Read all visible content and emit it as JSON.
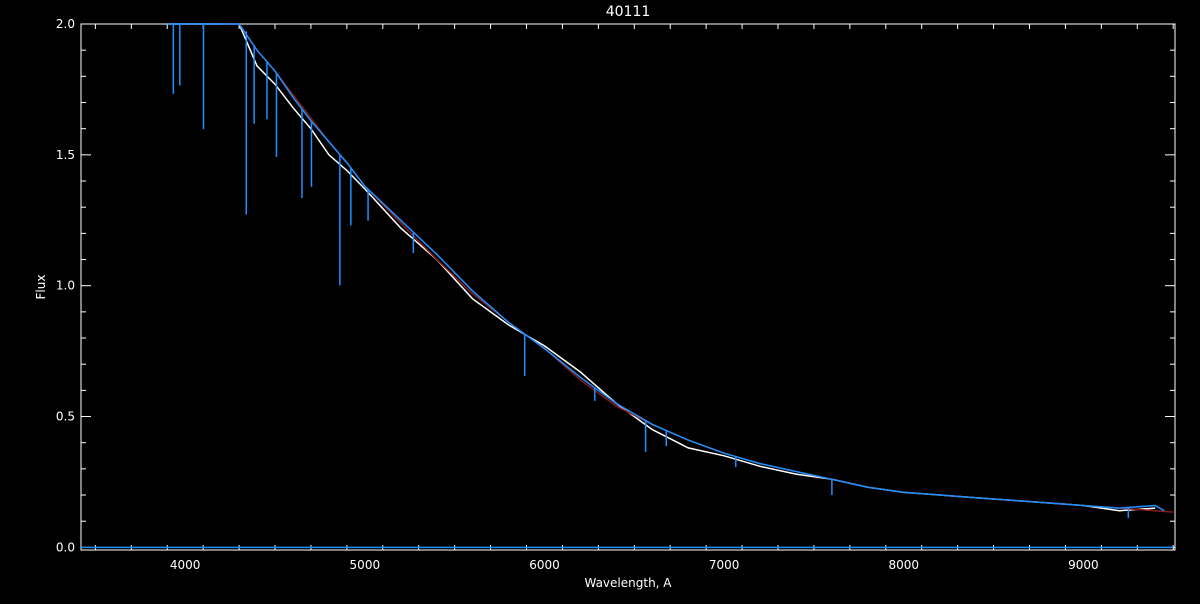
{
  "chart_data": {
    "type": "line",
    "title": "40111",
    "xlabel": "Wavelength, A",
    "ylabel": "Flux",
    "xlim": [
      3420,
      9510
    ],
    "ylim": [
      -0.01,
      2.0
    ],
    "x_ticks": [
      {
        "value": 4000,
        "label": "4000"
      },
      {
        "value": 5000,
        "label": "5000"
      },
      {
        "value": 6000,
        "label": "6000"
      },
      {
        "value": 7000,
        "label": "7000"
      },
      {
        "value": 8000,
        "label": "8000"
      },
      {
        "value": 9000,
        "label": "9000"
      }
    ],
    "y_ticks": [
      {
        "value": 0.0,
        "label": "0.0"
      },
      {
        "value": 0.5,
        "label": "0.5"
      },
      {
        "value": 1.0,
        "label": "1.0"
      },
      {
        "value": 1.5,
        "label": "1.5"
      },
      {
        "value": 2.0,
        "label": "2.0"
      }
    ],
    "grid": false,
    "series": [
      {
        "color": "#ffffff",
        "x": [
          3900,
          4100,
          4200,
          4300,
          4400,
          4500,
          4600,
          4700,
          4800,
          4900,
          5000,
          5200,
          5400,
          5600,
          5800,
          6000,
          6200,
          6400,
          6600,
          6800,
          7000,
          7200,
          7400,
          7600,
          7800,
          8000,
          8200,
          8400,
          8600,
          8800,
          9000,
          9200,
          9400
        ],
        "y": [
          2.3,
          2.2,
          2.1,
          2.0,
          1.84,
          1.77,
          1.68,
          1.6,
          1.5,
          1.44,
          1.37,
          1.22,
          1.1,
          0.95,
          0.85,
          0.77,
          0.67,
          0.55,
          0.45,
          0.38,
          0.35,
          0.31,
          0.28,
          0.26,
          0.23,
          0.21,
          0.2,
          0.19,
          0.18,
          0.17,
          0.16,
          0.14,
          0.15
        ]
      },
      {
        "color": "#8b1a1a",
        "x": [
          4200,
          4300,
          4400,
          4500,
          4600,
          4700,
          4800,
          4900,
          5000,
          5200,
          5400,
          5600,
          5800,
          6000,
          6200,
          6400,
          6600,
          6800,
          7000,
          7200,
          7400,
          7600,
          7800,
          8000,
          8200,
          8400,
          8600,
          8800,
          9000,
          9200,
          9400,
          9500
        ],
        "y": [
          2.1,
          2.0,
          1.9,
          1.82,
          1.73,
          1.64,
          1.55,
          1.47,
          1.38,
          1.24,
          1.1,
          0.97,
          0.86,
          0.76,
          0.64,
          0.54,
          0.47,
          0.41,
          0.36,
          0.32,
          0.29,
          0.26,
          0.23,
          0.21,
          0.2,
          0.19,
          0.18,
          0.17,
          0.16,
          0.15,
          0.14,
          0.135
        ]
      },
      {
        "color": "#1e90ff",
        "x": [
          3900,
          4100,
          4200,
          4300,
          4400,
          4500,
          4600,
          4700,
          4800,
          4900,
          5000,
          5200,
          5400,
          5600,
          5800,
          6000,
          6200,
          6400,
          6600,
          6800,
          7000,
          7200,
          7400,
          7600,
          7800,
          8000,
          8200,
          8400,
          8600,
          8800,
          9000,
          9200,
          9400,
          9450
        ],
        "y": [
          2.3,
          2.2,
          2.1,
          2.02,
          1.9,
          1.82,
          1.72,
          1.63,
          1.55,
          1.47,
          1.38,
          1.25,
          1.12,
          0.98,
          0.86,
          0.76,
          0.65,
          0.55,
          0.47,
          0.41,
          0.36,
          0.32,
          0.29,
          0.26,
          0.23,
          0.21,
          0.2,
          0.19,
          0.18,
          0.17,
          0.16,
          0.15,
          0.16,
          0.14
        ]
      },
      {
        "color": "#1e90ff",
        "x": [
          3420,
          9500
        ],
        "y": [
          0.0,
          0.0
        ]
      }
    ],
    "absorption_lines": [
      {
        "x": 3934,
        "depth": 0.55,
        "color": "#1e90ff"
      },
      {
        "x": 3970,
        "depth": 0.5,
        "color": "#1e90ff"
      },
      {
        "x": 4102,
        "depth": 0.6,
        "color": "#1e90ff"
      },
      {
        "x": 4340,
        "depth": 0.7,
        "color": "#1e90ff"
      },
      {
        "x": 4384,
        "depth": 0.3,
        "color": "#1e90ff"
      },
      {
        "x": 4455,
        "depth": 0.22,
        "color": "#1e90ff"
      },
      {
        "x": 4508,
        "depth": 0.32,
        "color": "#1e90ff"
      },
      {
        "x": 4650,
        "depth": 0.34,
        "color": "#1e90ff"
      },
      {
        "x": 4703,
        "depth": 0.25,
        "color": "#1e90ff"
      },
      {
        "x": 4861,
        "depth": 0.5,
        "color": "#1e90ff"
      },
      {
        "x": 4922,
        "depth": 0.22,
        "color": "#1e90ff"
      },
      {
        "x": 5018,
        "depth": 0.12,
        "color": "#1e90ff"
      },
      {
        "x": 5270,
        "depth": 0.08,
        "color": "#1e90ff"
      },
      {
        "x": 5890,
        "depth": 0.16,
        "color": "#1e90ff"
      },
      {
        "x": 6280,
        "depth": 0.05,
        "color": "#1e90ff"
      },
      {
        "x": 6563,
        "depth": 0.12,
        "color": "#1e90ff"
      },
      {
        "x": 6678,
        "depth": 0.06,
        "color": "#1e90ff"
      },
      {
        "x": 7065,
        "depth": 0.04,
        "color": "#1e90ff"
      },
      {
        "x": 7600,
        "depth": 0.06,
        "color": "#1e90ff"
      },
      {
        "x": 9250,
        "depth": 0.04,
        "color": "#1e90ff"
      }
    ]
  }
}
